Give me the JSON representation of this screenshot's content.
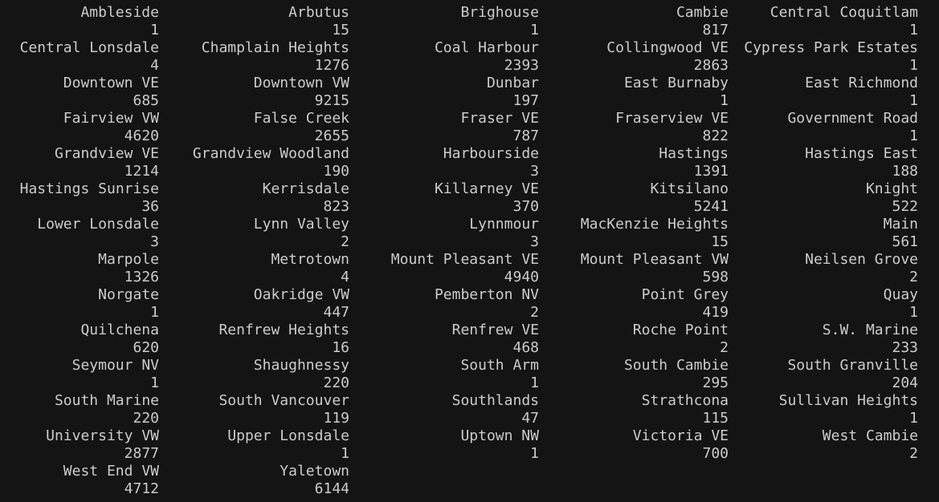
{
  "console": {
    "colors": {
      "background": "#141414",
      "text": "#cccccc"
    },
    "table": [
      {
        "name": "Ambleside",
        "count": "1"
      },
      {
        "name": "Arbutus",
        "count": "15"
      },
      {
        "name": "Brighouse",
        "count": "1"
      },
      {
        "name": "Cambie",
        "count": "817"
      },
      {
        "name": "Central Coquitlam",
        "count": "1"
      },
      {
        "name": "Central Lonsdale",
        "count": "4"
      },
      {
        "name": "Champlain Heights",
        "count": "1276"
      },
      {
        "name": "Coal Harbour",
        "count": "2393"
      },
      {
        "name": "Collingwood VE",
        "count": "2863"
      },
      {
        "name": "Cypress Park Estates",
        "count": "1"
      },
      {
        "name": "Downtown VE",
        "count": "685"
      },
      {
        "name": "Downtown VW",
        "count": "9215"
      },
      {
        "name": "Dunbar",
        "count": "197"
      },
      {
        "name": "East Burnaby",
        "count": "1"
      },
      {
        "name": "East Richmond",
        "count": "1"
      },
      {
        "name": "Fairview VW",
        "count": "4620"
      },
      {
        "name": "False Creek",
        "count": "2655"
      },
      {
        "name": "Fraser VE",
        "count": "787"
      },
      {
        "name": "Fraserview VE",
        "count": "822"
      },
      {
        "name": "Government Road",
        "count": "1"
      },
      {
        "name": "Grandview VE",
        "count": "1214"
      },
      {
        "name": "Grandview Woodland",
        "count": "190"
      },
      {
        "name": "Harbourside",
        "count": "3"
      },
      {
        "name": "Hastings",
        "count": "1391"
      },
      {
        "name": "Hastings East",
        "count": "188"
      },
      {
        "name": "Hastings Sunrise",
        "count": "36"
      },
      {
        "name": "Kerrisdale",
        "count": "823"
      },
      {
        "name": "Killarney VE",
        "count": "370"
      },
      {
        "name": "Kitsilano",
        "count": "5241"
      },
      {
        "name": "Knight",
        "count": "522"
      },
      {
        "name": "Lower Lonsdale",
        "count": "3"
      },
      {
        "name": "Lynn Valley",
        "count": "2"
      },
      {
        "name": "Lynnmour",
        "count": "3"
      },
      {
        "name": "MacKenzie Heights",
        "count": "15"
      },
      {
        "name": "Main",
        "count": "561"
      },
      {
        "name": "Marpole",
        "count": "1326"
      },
      {
        "name": "Metrotown",
        "count": "4"
      },
      {
        "name": "Mount Pleasant VE",
        "count": "4940"
      },
      {
        "name": "Mount Pleasant VW",
        "count": "598"
      },
      {
        "name": "Neilsen Grove",
        "count": "2"
      },
      {
        "name": "Norgate",
        "count": "1"
      },
      {
        "name": "Oakridge VW",
        "count": "447"
      },
      {
        "name": "Pemberton NV",
        "count": "2"
      },
      {
        "name": "Point Grey",
        "count": "419"
      },
      {
        "name": "Quay",
        "count": "1"
      },
      {
        "name": "Quilchena",
        "count": "620"
      },
      {
        "name": "Renfrew Heights",
        "count": "16"
      },
      {
        "name": "Renfrew VE",
        "count": "468"
      },
      {
        "name": "Roche Point",
        "count": "2"
      },
      {
        "name": "S.W. Marine",
        "count": "233"
      },
      {
        "name": "Seymour NV",
        "count": "1"
      },
      {
        "name": "Shaughnessy",
        "count": "220"
      },
      {
        "name": "South Arm",
        "count": "1"
      },
      {
        "name": "South Cambie",
        "count": "295"
      },
      {
        "name": "South Granville",
        "count": "204"
      },
      {
        "name": "South Marine",
        "count": "220"
      },
      {
        "name": "South Vancouver",
        "count": "119"
      },
      {
        "name": "Southlands",
        "count": "47"
      },
      {
        "name": "Strathcona",
        "count": "115"
      },
      {
        "name": "Sullivan Heights",
        "count": "1"
      },
      {
        "name": "University VW",
        "count": "2877"
      },
      {
        "name": "Upper Lonsdale",
        "count": "1"
      },
      {
        "name": "Uptown NW",
        "count": "1"
      },
      {
        "name": "Victoria VE",
        "count": "700"
      },
      {
        "name": "West Cambie",
        "count": "2"
      },
      {
        "name": "West End VW",
        "count": "4712"
      },
      {
        "name": "Yaletown",
        "count": "6144"
      }
    ]
  }
}
